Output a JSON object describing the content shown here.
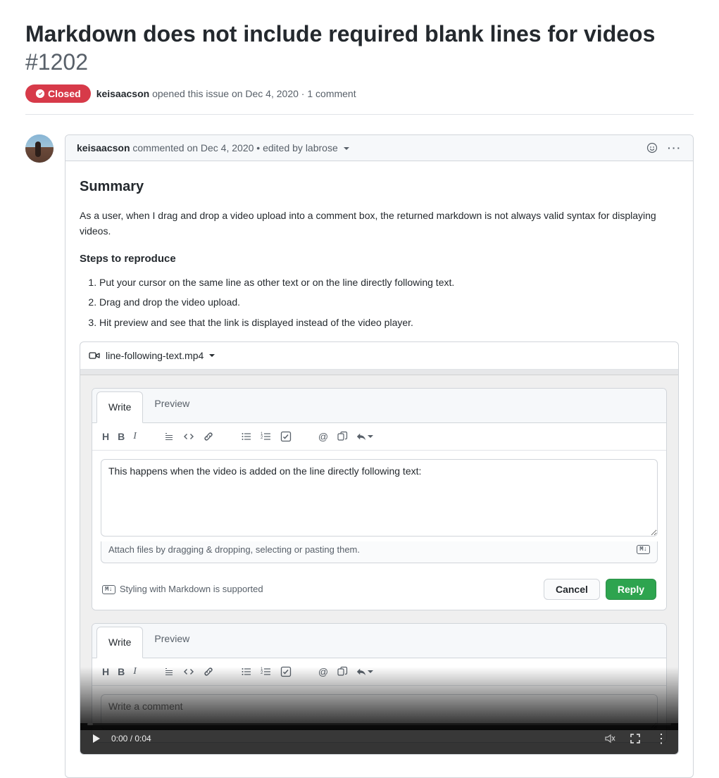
{
  "issue": {
    "title": "Markdown does not include required blank lines for videos",
    "number": "#1202",
    "state_label": "Closed",
    "opener": "keisaacson",
    "opened_text": "opened this issue",
    "opened_date": "on Dec 4, 2020",
    "comment_count": "1 comment"
  },
  "comment": {
    "author": "keisaacson",
    "action": "commented",
    "date": "on Dec 4, 2020",
    "edited_prefix": "edited by",
    "edited_by": "labrose",
    "summary_heading": "Summary",
    "summary_text": "As a user, when I drag and drop a video upload into a comment box, the returned markdown is not always valid syntax for displaying videos.",
    "steps_heading": "Steps to reproduce",
    "steps": [
      "Put your cursor on the same line as other text or on the line directly following text.",
      "Drag and drop the video upload.",
      "Hit preview and see that the link is displayed instead of the video player."
    ]
  },
  "attachment": {
    "filename": "line-following-text.mp4"
  },
  "editor": {
    "tab_write": "Write",
    "tab_preview": "Preview",
    "toolbar": {
      "heading": "H",
      "bold": "B",
      "italic": "I"
    },
    "textarea_text": "This happens when the video is added on the line directly following text:",
    "attach_hint": "Attach files by dragging & dropping, selecting or pasting them.",
    "md_supported": "Styling with Markdown is supported",
    "cancel": "Cancel",
    "reply": "Reply",
    "placeholder2": "Write a comment"
  },
  "video": {
    "time": "0:00 / 0:04"
  }
}
